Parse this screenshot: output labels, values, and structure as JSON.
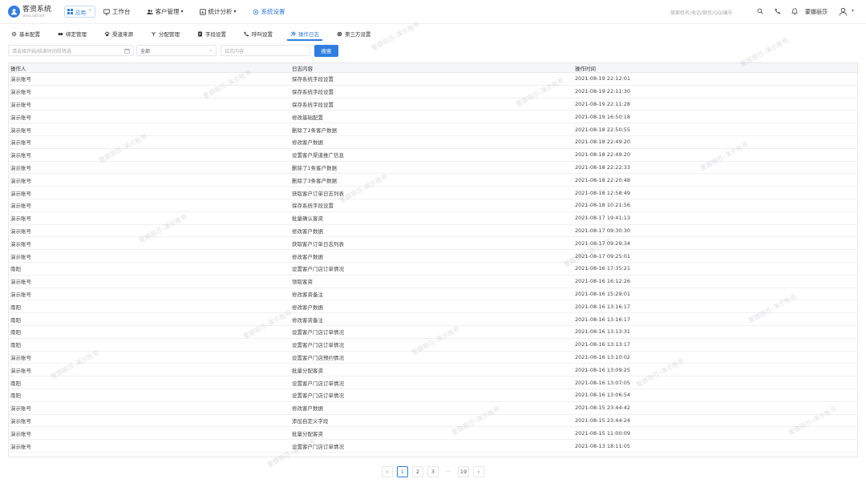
{
  "header": {
    "logo_title": "客资系统",
    "logo_subtitle": "lzhlcs.lyfz.net",
    "app_label": "应用",
    "nav": [
      {
        "label": "工作台",
        "icon": "monitor-icon",
        "has_caret": false
      },
      {
        "label": "客户管理",
        "icon": "users-icon",
        "has_caret": true
      },
      {
        "label": "统计分析",
        "icon": "chart-icon",
        "has_caret": true
      },
      {
        "label": "系统设置",
        "icon": "settings-icon",
        "has_caret": false
      }
    ],
    "search_placeholder": "搜索姓名/电话/微信/QQ/编号",
    "username": "蒙娜丽莎"
  },
  "tabs": [
    {
      "label": "基本配置",
      "icon": "gear-icon"
    },
    {
      "label": "绑定管理",
      "icon": "binding-icon"
    },
    {
      "label": "渠道来源",
      "icon": "paw-icon"
    },
    {
      "label": "分配管理",
      "icon": "fork-icon"
    },
    {
      "label": "字段设置",
      "icon": "doc-icon"
    },
    {
      "label": "呼叫设置",
      "icon": "phone-icon"
    },
    {
      "label": "操作日志",
      "icon": "tools-icon"
    },
    {
      "label": "第三方设置",
      "icon": "globe-icon"
    }
  ],
  "active_tab": 6,
  "filters": {
    "date_placeholder": "请选择开始/结束时间段筛选",
    "select_value": "全部",
    "content_placeholder": "日志内容",
    "search_button": "搜索"
  },
  "table": {
    "columns": [
      "操作人",
      "日志内容",
      "操作时间"
    ],
    "rows": [
      [
        "演示账号",
        "保存系统字段设置",
        "2021-08-19 22:12:01"
      ],
      [
        "演示账号",
        "保存系统字段设置",
        "2021-08-19 22:11:30"
      ],
      [
        "演示账号",
        "保存系统字段设置",
        "2021-08-19 22:11:28"
      ],
      [
        "演示账号",
        "修改基础配置",
        "2021-08-19 16:50:18"
      ],
      [
        "演示账号",
        "删除了2条客户数据",
        "2021-08-18 22:50:55"
      ],
      [
        "演示账号",
        "修改客户数据",
        "2021-08-18 22:49:20"
      ],
      [
        "演示账号",
        "设置客户渠道推广信息",
        "2021-08-18 22:49:20"
      ],
      [
        "演示账号",
        "删除了1条客户数据",
        "2021-08-18 22:22:33"
      ],
      [
        "演示账号",
        "删除了3条客户数据",
        "2021-08-18 22:20:48"
      ],
      [
        "演示账号",
        "获取客户订单日志列表",
        "2021-08-18 12:58:49"
      ],
      [
        "演示账号",
        "保存系统字段设置",
        "2021-08-18 10:21:56"
      ],
      [
        "演示账号",
        "批量确认客资",
        "2021-08-17 19:41:13"
      ],
      [
        "演示账号",
        "修改客户数据",
        "2021-08-17 09:30:30"
      ],
      [
        "演示账号",
        "获取客户订单日志列表",
        "2021-08-17 09:29:34"
      ],
      [
        "演示账号",
        "修改客户数据",
        "2021-08-17 09:25:01"
      ],
      [
        "南阳",
        "设置客户门店订单情况",
        "2021-08-16 17:35:21"
      ],
      [
        "演示账号",
        "领取客资",
        "2021-08-16 16:12:26"
      ],
      [
        "演示账号",
        "修改客资备注",
        "2021-08-16 15:29:01"
      ],
      [
        "南阳",
        "修改客户数据",
        "2021-08-16 13:16:17"
      ],
      [
        "南阳",
        "修改客资备注",
        "2021-08-16 13:16:17"
      ],
      [
        "南阳",
        "设置客户门店订单情况",
        "2021-08-16 13:13:31"
      ],
      [
        "南阳",
        "设置客户门店订单情况",
        "2021-08-16 13:13:17"
      ],
      [
        "演示账号",
        "设置客户门店预约情况",
        "2021-08-16 13:10:02"
      ],
      [
        "演示账号",
        "批量分配客资",
        "2021-08-16 13:09:25"
      ],
      [
        "南阳",
        "设置客户门店订单情况",
        "2021-08-16 13:07:05"
      ],
      [
        "南阳",
        "设置客户门店订单情况",
        "2021-08-16 13:06:54"
      ],
      [
        "演示账号",
        "修改客户数据",
        "2021-08-15 23:44:42"
      ],
      [
        "演示账号",
        "添加自定义字段",
        "2021-08-15 23:44:24"
      ],
      [
        "演示账号",
        "批量分配客资",
        "2021-08-15 11:00:09"
      ],
      [
        "演示账号",
        "设置客户门店订单情况",
        "2021-08-13 18:11:05"
      ]
    ]
  },
  "pagination": {
    "prev": "‹",
    "pages": [
      "1",
      "2",
      "3"
    ],
    "ellipsis": "···",
    "last": "19",
    "next": "›",
    "current": "1"
  },
  "watermark_text": "蒙娜丽莎-演示账号",
  "colors": {
    "accent": "#2f7de1"
  }
}
